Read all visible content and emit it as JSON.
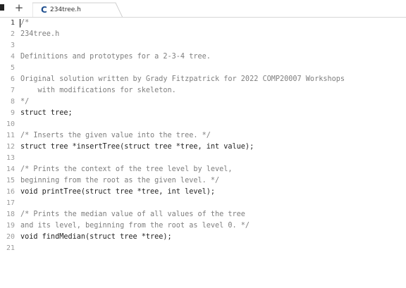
{
  "tab": {
    "title": "234tree.h",
    "icon": "c-language-icon",
    "icon_glyph": "C",
    "icon_color": "#1f4f8f"
  },
  "new_tab": {
    "label": "+"
  },
  "editor": {
    "active_line": 1,
    "lines": [
      {
        "number": "1",
        "text": "/*",
        "kind": "comment"
      },
      {
        "number": "2",
        "text": "234tree.h",
        "kind": "comment"
      },
      {
        "number": "3",
        "text": "",
        "kind": "comment"
      },
      {
        "number": "4",
        "text": "Definitions and prototypes for a 2-3-4 tree.",
        "kind": "comment"
      },
      {
        "number": "5",
        "text": "",
        "kind": "comment"
      },
      {
        "number": "6",
        "text": "Original solution written by Grady Fitzpatrick for 2022 COMP20007 Workshops",
        "kind": "comment"
      },
      {
        "number": "7",
        "text": "    with modifications for skeleton.",
        "kind": "comment"
      },
      {
        "number": "8",
        "text": "*/",
        "kind": "comment"
      },
      {
        "number": "9",
        "text": "struct tree;",
        "kind": "code"
      },
      {
        "number": "10",
        "text": "",
        "kind": "code"
      },
      {
        "number": "11",
        "text": "/* Inserts the given value into the tree. */",
        "kind": "comment"
      },
      {
        "number": "12",
        "text": "struct tree *insertTree(struct tree *tree, int value);",
        "kind": "code"
      },
      {
        "number": "13",
        "text": "",
        "kind": "code"
      },
      {
        "number": "14",
        "text": "/* Prints the context of the tree level by level,",
        "kind": "comment"
      },
      {
        "number": "15",
        "text": "beginning from the root as the given level. */",
        "kind": "comment"
      },
      {
        "number": "16",
        "text": "void printTree(struct tree *tree, int level);",
        "kind": "code"
      },
      {
        "number": "17",
        "text": "",
        "kind": "code"
      },
      {
        "number": "18",
        "text": "/* Prints the median value of all values of the tree",
        "kind": "comment"
      },
      {
        "number": "19",
        "text": "and its level, beginning from the root as level 0. */",
        "kind": "comment"
      },
      {
        "number": "20",
        "text": "void findMedian(struct tree *tree);",
        "kind": "code"
      },
      {
        "number": "21",
        "text": "",
        "kind": "code"
      }
    ]
  }
}
